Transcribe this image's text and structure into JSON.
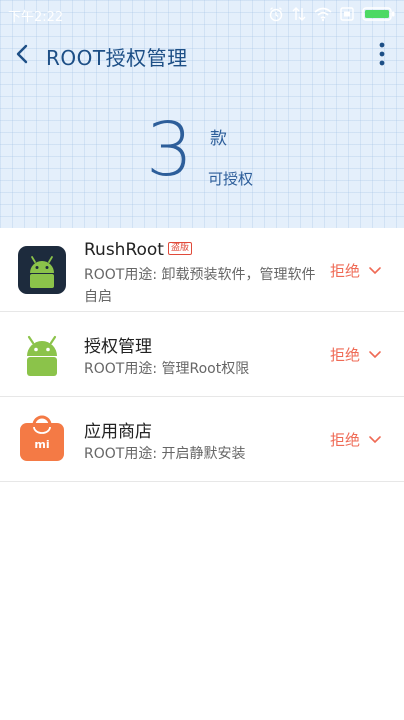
{
  "status_bar": {
    "time": "下午2:22",
    "icons": [
      "alarm-icon",
      "data-signal-icon",
      "wifi-icon",
      "sim-icon",
      "battery-icon"
    ]
  },
  "header": {
    "title": "ROOT授权管理",
    "count": "3",
    "count_unit": "款",
    "count_caption": "可授权"
  },
  "apps": [
    {
      "name": "RushRoot",
      "badge": "盗版",
      "desc": "ROOT用途: 卸载预装软件，管理软件自启",
      "action": "拒绝",
      "icon": "android-icon"
    },
    {
      "name": "授权管理",
      "desc": "ROOT用途: 管理Root权限",
      "action": "拒绝",
      "icon": "android-icon"
    },
    {
      "name": "应用商店",
      "desc": "ROOT用途: 开启静默安装",
      "action": "拒绝",
      "icon": "mi-store-icon"
    }
  ],
  "colors": {
    "accent": "#2d5e9a",
    "deny": "#ef6a55",
    "header_bg": "#e4effb",
    "android_green": "#8bc34a",
    "mi_orange": "#f47a45"
  }
}
